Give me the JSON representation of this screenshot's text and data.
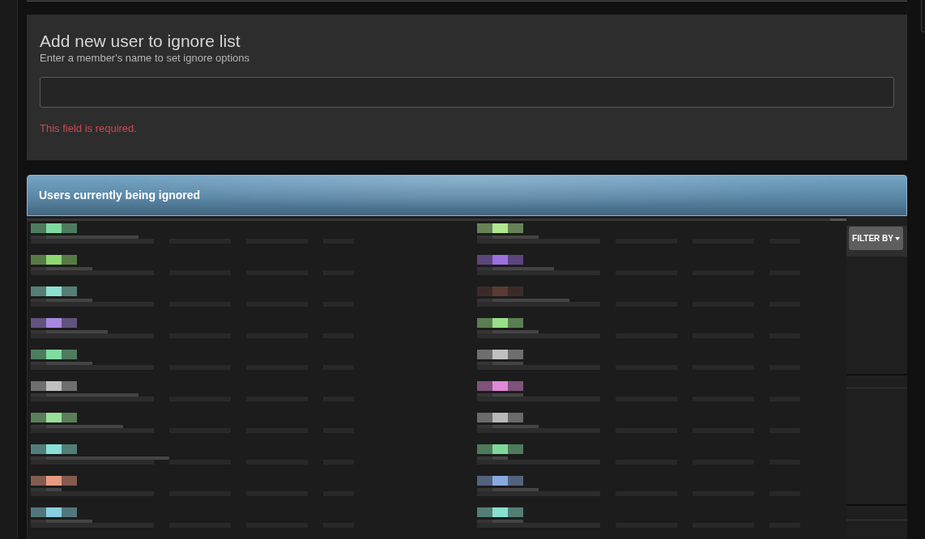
{
  "form": {
    "title": "Add new user to ignore list",
    "subtitle": "Enter a member's name to set ignore options",
    "error": "This field is required."
  },
  "ignored_users": {
    "title": "Users currently being ignored",
    "filter_button": "FILTER BY",
    "columns": [
      {
        "users": [
          {
            "color": "#7fd9a0"
          },
          {
            "color": "#8fd870"
          },
          {
            "color": "#8ee0d0"
          },
          {
            "color": "#a888e0"
          },
          {
            "color": "#80dca0"
          },
          {
            "color": "#c0c0c0"
          },
          {
            "color": "#98e098"
          },
          {
            "color": "#88e0d8"
          },
          {
            "color": "#e89a80"
          },
          {
            "color": "#88d0e0"
          }
        ]
      },
      {
        "users": [
          {
            "color": "#b0e890"
          },
          {
            "color": "#9c70e0"
          },
          {
            "color": "#5a3a34"
          },
          {
            "color": "#98e088"
          },
          {
            "color": "#c0c0c0"
          },
          {
            "color": "#e088d8"
          },
          {
            "color": "#b8b8b8"
          },
          {
            "color": "#80d898"
          },
          {
            "color": "#88aae0"
          },
          {
            "color": "#88e0d0"
          }
        ]
      }
    ]
  }
}
